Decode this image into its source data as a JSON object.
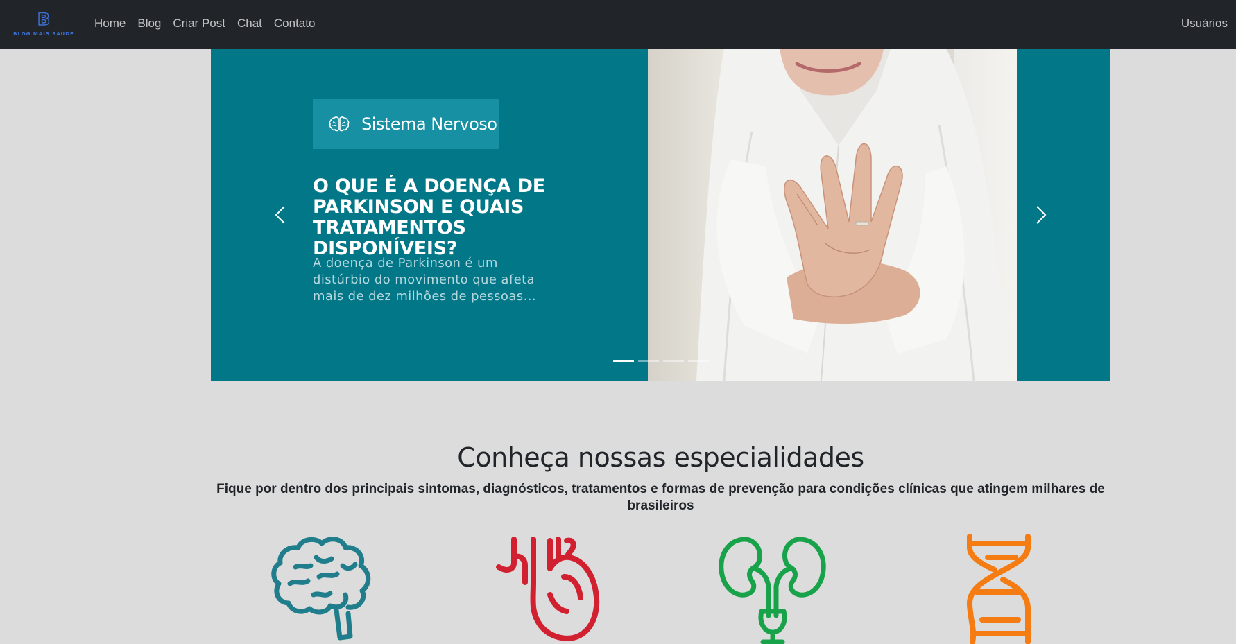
{
  "navbar": {
    "brand_letter": "B",
    "brand_name": "BLOG MAIS SAÚDE",
    "links": [
      "Home",
      "Blog",
      "Criar Post",
      "Chat",
      "Contato"
    ],
    "right_link": "Usuários"
  },
  "carousel": {
    "category": "Sistema Nervoso",
    "category_icon": "brain-icon",
    "title": "O que é a doença de Parkinson e quais tratamentos disponíveis?",
    "excerpt": "A doença de Parkinson é um distúrbio do movimento que afeta mais de dez milhões de pessoas...",
    "active_slide": 1,
    "slide_count": 4,
    "colors": {
      "background": "#027788",
      "badge": "#1790a3"
    }
  },
  "specialties": {
    "heading": "Conheça nossas especialidades",
    "subheading": "Fique por dentro dos principais sintomas, diagnósticos, tratamentos e formas de prevenção para condições clínicas que atingem milhares de brasileiros",
    "icons": [
      {
        "name": "brain-icon",
        "color": "#1f7d8c"
      },
      {
        "name": "heart-icon",
        "color": "#d1202f"
      },
      {
        "name": "kidney-icon",
        "color": "#18a34a"
      },
      {
        "name": "dna-icon",
        "color": "#f57c12"
      }
    ]
  }
}
